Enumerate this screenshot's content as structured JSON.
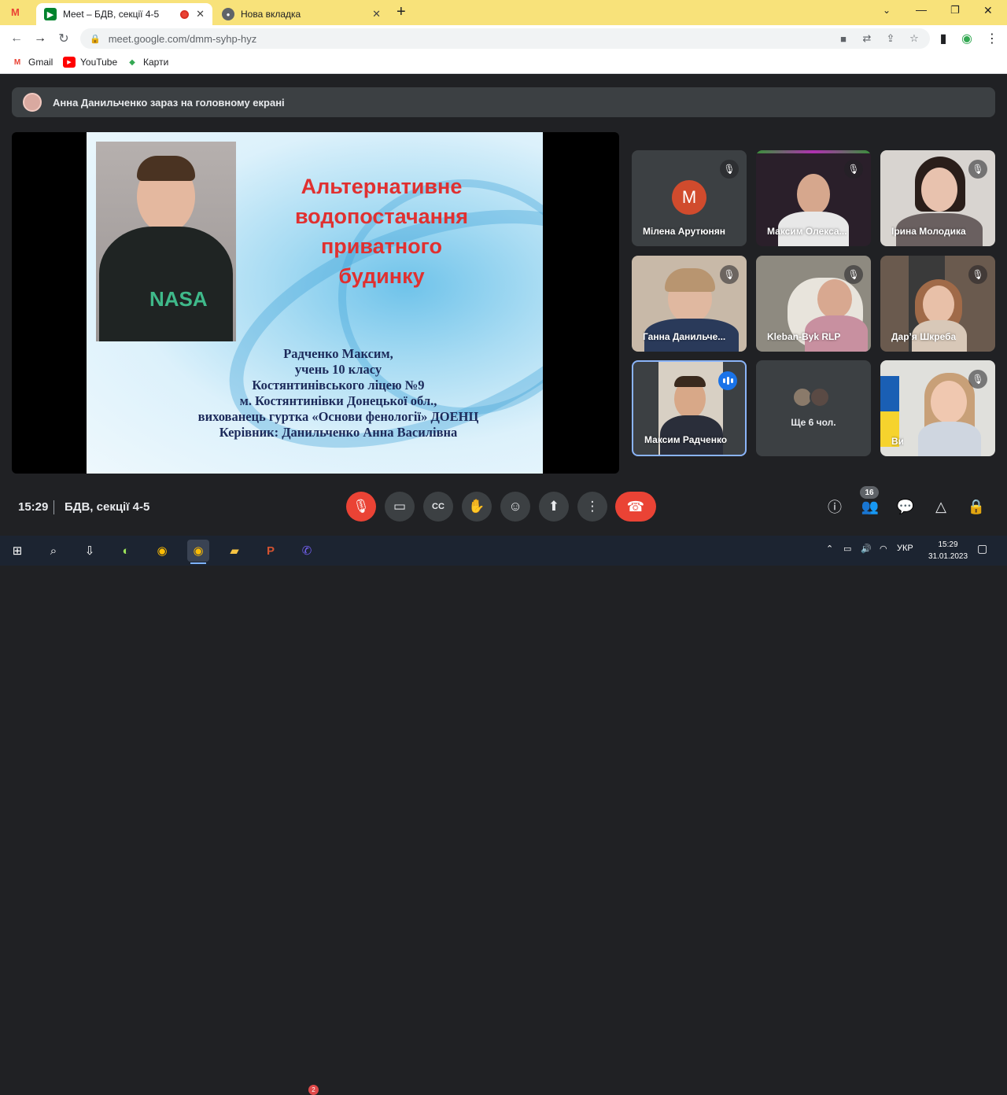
{
  "browser": {
    "tabs": [
      {
        "title": "Meet – БДВ, секції 4-5",
        "active": true,
        "recording": true
      },
      {
        "title": "Нова вкладка",
        "active": false
      }
    ],
    "new_tab_symbol": "+",
    "url": "meet.google.com/dmm-syhp-hyz",
    "bookmarks": [
      {
        "label": "Gmail",
        "icon": "gmail-icon"
      },
      {
        "label": "YouTube",
        "icon": "youtube-icon"
      },
      {
        "label": "Карти",
        "icon": "maps-icon"
      }
    ]
  },
  "meet": {
    "presenting_banner": "Анна Данильченко зараз на головному екрані",
    "slide": {
      "title_lines": [
        "Альтернативне",
        "водопостачання",
        "приватного",
        "будинку"
      ],
      "author_lines": [
        "Радченко Максим,",
        "учень 10 класу",
        "Костянтинівського ліцею №9",
        "м. Костянтинівки Донецької обл.,",
        "вихованець гуртка «Основи фенології» ДОЕНЦ",
        "Керівник: Данильченко Анна Василівна"
      ]
    },
    "participants": [
      {
        "name": "Мілена Арутюнян",
        "initial": "М",
        "muted": true
      },
      {
        "name": "Максим Олекса...",
        "muted": true
      },
      {
        "name": "Ірина Молодика",
        "muted": true
      },
      {
        "name": "Ганна Данильче...",
        "muted": true
      },
      {
        "name": "Kleban-Byk RLP",
        "muted": true
      },
      {
        "name": "Дар’я Шкреба",
        "muted": true
      },
      {
        "name": "Максим Радченко",
        "speaking": true
      },
      {
        "name": "Ще 6 чол."
      },
      {
        "name": "Ви",
        "muted": true
      }
    ],
    "time": "15:29",
    "meeting_name": "БДВ, секції 4-5",
    "people_count": "16"
  },
  "taskbar": {
    "language": "УКР",
    "time": "15:29",
    "date": "31.01.2023",
    "viber_badge": "2"
  },
  "colors": {
    "tab_bar": "#f8e27a",
    "meet_bg": "#202124",
    "tile_bg": "#3c4043",
    "end_call": "#ea4335",
    "slide_title": "#e03030"
  }
}
